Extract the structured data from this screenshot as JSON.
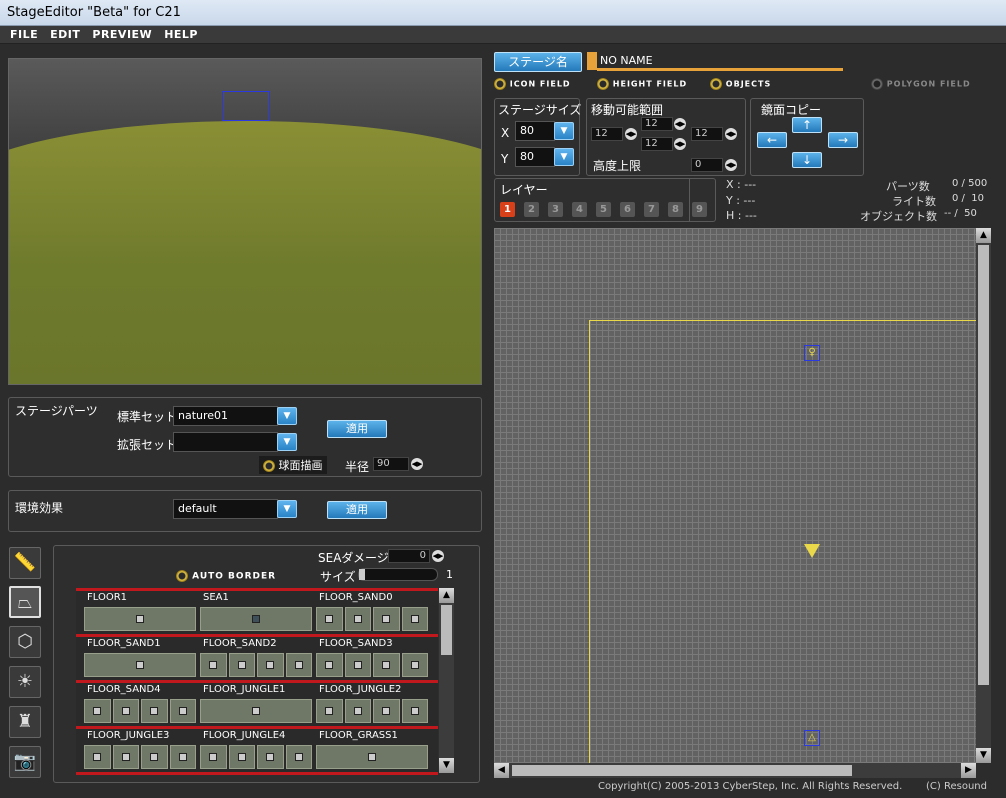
{
  "window": {
    "title": "StageEditor \"Beta\" for C21"
  },
  "menu": [
    "FILE",
    "EDIT",
    "PREVIEW",
    "HELP"
  ],
  "stage": {
    "name_button": "ステージ名",
    "name_value": "NO NAME"
  },
  "fields": {
    "icon": "ICON FIELD",
    "height": "HEIGHT FIELD",
    "objects": "OBJECTS",
    "polygon": "POLYGON FIELD"
  },
  "stage_size": {
    "title": "ステージサイズ",
    "x_label": "X",
    "x_value": "80",
    "y_label": "Y",
    "y_value": "80"
  },
  "movable": {
    "title": "移動可能範囲",
    "left": "12",
    "top": "12",
    "bottom": "12",
    "right": "12",
    "height_label": "高度上限",
    "height_value": "0"
  },
  "mirror": {
    "title": "鏡面コピー",
    "up": "↑",
    "left": "←",
    "right": "→",
    "down": "↓"
  },
  "layer": {
    "title": "レイヤー",
    "buttons": [
      "1",
      "2",
      "3",
      "4",
      "5",
      "6",
      "7",
      "8",
      "9"
    ]
  },
  "coords": {
    "x": "X : ---",
    "y": "Y : ---",
    "h": "H : ---"
  },
  "counts": {
    "parts_label": "パーツ数",
    "parts_value": "0 / 500",
    "light_label": "ライト数",
    "light_value": "0 /  10",
    "object_label": "オブジェクト数",
    "object_value": "-- /  50"
  },
  "stage_parts": {
    "title": "ステージパーツ",
    "std_label": "標準セット",
    "std_value": "nature01",
    "ext_label": "拡張セット",
    "ext_value": "",
    "apply": "適用",
    "sphere_label": "球面描画",
    "radius_label": "半径",
    "radius_value": "90"
  },
  "env": {
    "title": "環境効果",
    "value": "default",
    "apply": "適用"
  },
  "sea": {
    "damage_label": "SEAダメージ",
    "damage_value": "0",
    "size_label": "サイズ",
    "size_value": "1",
    "auto_border": "AUTO BORDER"
  },
  "tiles": [
    {
      "name": "FLOOR1",
      "n": 1,
      "dark": false
    },
    {
      "name": "SEA1",
      "n": 1,
      "dark": true
    },
    {
      "name": "FLOOR_SAND0",
      "n": 4,
      "dark": false
    },
    {
      "name": "FLOOR_SAND1",
      "n": 1,
      "dark": false
    },
    {
      "name": "FLOOR_SAND2",
      "n": 4,
      "dark": false
    },
    {
      "name": "FLOOR_SAND3",
      "n": 4,
      "dark": false
    },
    {
      "name": "FLOOR_SAND4",
      "n": 4,
      "dark": false
    },
    {
      "name": "FLOOR_JUNGLE1",
      "n": 1,
      "dark": false
    },
    {
      "name": "FLOOR_JUNGLE2",
      "n": 4,
      "dark": false
    },
    {
      "name": "FLOOR_JUNGLE3",
      "n": 4,
      "dark": false
    },
    {
      "name": "FLOOR_JUNGLE4",
      "n": 4,
      "dark": false
    },
    {
      "name": "FLOOR_GRASS1",
      "n": 1,
      "dark": false
    }
  ],
  "footer": {
    "copyright": "Copyright(C) 2005-2013 CyberStep, Inc. All Rights Reserved.",
    "resound": "(C) Resound"
  },
  "colors": {
    "accent": "#2f8fd3",
    "grid_bg": "#626262",
    "border_yellow": "#e8d84a",
    "layer_active": "#d8401a"
  }
}
